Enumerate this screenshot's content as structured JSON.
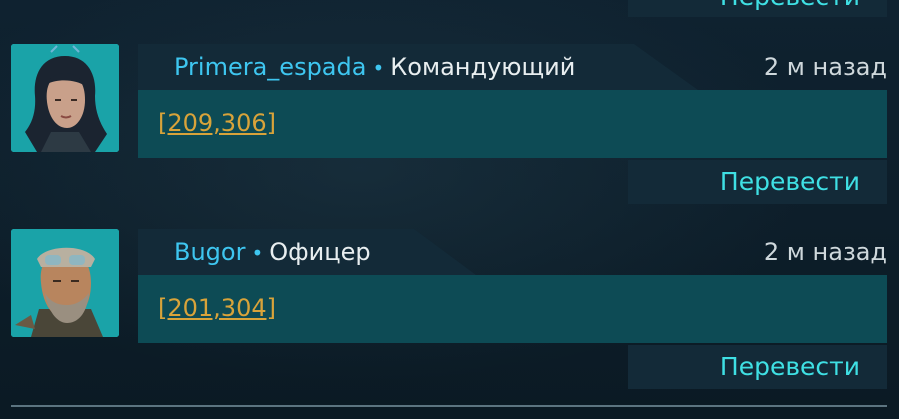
{
  "translate_label": "Перевести",
  "messages": [
    {
      "author": "Primera_espada",
      "separator": "•",
      "rank": "Командующий",
      "time": "2 м назад",
      "text": "[209,306]",
      "avatar": "female-commander-portrait"
    },
    {
      "author": "Bugor",
      "separator": "•",
      "rank": "Офицер",
      "time": "2 м назад",
      "text": "[201,304]",
      "avatar": "bearded-officer-portrait"
    }
  ],
  "colors": {
    "background": "#0c1c26",
    "author": "#3ec6f0",
    "rank": "#e8eef0",
    "message_body": "#0d4b55",
    "header_plate": "#132a38",
    "translate_text": "#3fe0e4",
    "coordinate_link": "#d8a33a"
  }
}
